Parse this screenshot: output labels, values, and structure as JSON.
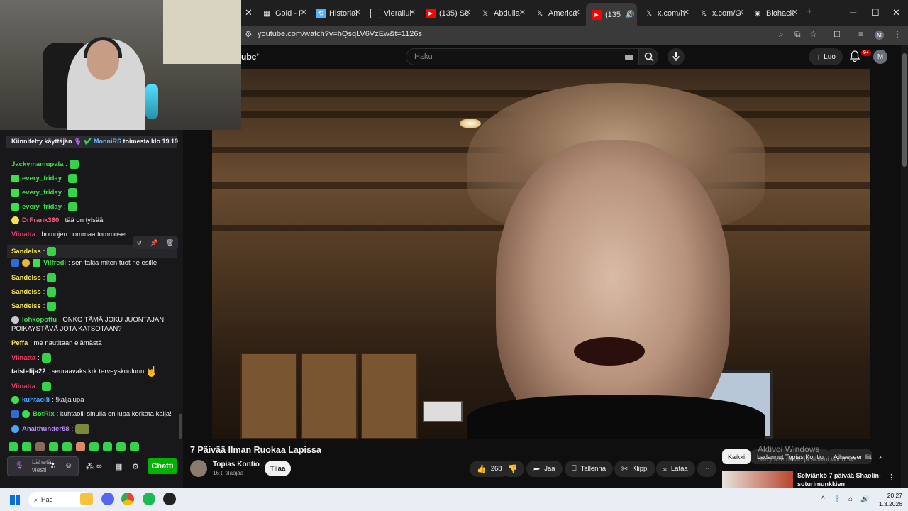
{
  "browser": {
    "tabs": [
      {
        "title": "Gold - P",
        "icon": "chart-icon",
        "color": "#ffffff"
      },
      {
        "title": "Historial",
        "icon": "history-icon",
        "color": "#4cb3ff"
      },
      {
        "title": "Vierailul",
        "icon": "page-icon",
        "color": "#9aa0a6"
      },
      {
        "title": "(135) Sel",
        "icon": "youtube-icon",
        "color": "#ff0000"
      },
      {
        "title": "Abdulla",
        "icon": "x-icon",
        "color": "#ffffff"
      },
      {
        "title": "America",
        "icon": "x-icon",
        "color": "#ffffff"
      },
      {
        "title": "(135",
        "icon": "youtube-icon",
        "color": "#ff0000"
      },
      {
        "title": "x.com/h",
        "icon": "x-icon",
        "color": "#ffffff"
      },
      {
        "title": "x.com/G",
        "icon": "x-icon",
        "color": "#ffffff"
      },
      {
        "title": "Biohack",
        "icon": "globe-icon",
        "color": "#ffffff"
      }
    ],
    "url": "youtube.com/watch?v=hQsqLV6VzEw&t=1126s"
  },
  "youtube": {
    "logo": "ube",
    "logo_region": "FI",
    "search_placeholder": "Haku",
    "create_label": "Luo",
    "notif_count": "9+",
    "avatar_letter": "M"
  },
  "video": {
    "title": "7 Päivää Ilman Ruokaa Lapissa",
    "channel": "Topias Kontio",
    "subs": "16 t. tilaajaa",
    "subscribe": "Tilaa",
    "likes": "268",
    "share": "Jaa",
    "save": "Tallenna",
    "clip": "Klippi",
    "download": "Lataa"
  },
  "sidebar": {
    "chips": [
      "Kaikki",
      "Ladannut Topias Kontio",
      "Aiheeseen liit"
    ],
    "related_title": "Selviänkö 7 päivää Shaolin-soturimunkkien koulutuksessa?"
  },
  "watermark": {
    "line1": "Aktivoi Windows",
    "line2": "Siirry asetuksiin ja aktivoi Windows."
  },
  "chat": {
    "pinned_prefix": "Kiinnitetty käyttäjän",
    "pinned_user": "MonniRS",
    "pinned_suffix": "toimesta klo 19.19",
    "messages": [
      {
        "user": "Jackymamupala",
        "color": "#3ce04a",
        "text": ""
      },
      {
        "user": "every_friday",
        "color": "#3ce04a",
        "text": ""
      },
      {
        "user": "every_friday",
        "color": "#3ce04a",
        "text": ""
      },
      {
        "user": "every_friday",
        "color": "#3ce04a",
        "text": ""
      },
      {
        "user": "DrFrank360",
        "color": "#ff5c8a",
        "text": "tää on tylsää"
      },
      {
        "user": "Viinatta",
        "color": "#ff3a6a",
        "text": "homojen hommaa tommoset"
      },
      {
        "user": "Sandelss",
        "color": "#f3e14b",
        "text": ""
      },
      {
        "user": "Vilfredi",
        "color": "#3ce04a",
        "text": "sen takia miten tuot ne esille"
      },
      {
        "user": "Sandelss",
        "color": "#f3e14b",
        "text": ""
      },
      {
        "user": "Sandelss",
        "color": "#f3e14b",
        "text": ""
      },
      {
        "user": "Sandelss",
        "color": "#f3e14b",
        "text": ""
      },
      {
        "user": "lohkopottu",
        "color": "#3ce04a",
        "text": "ONKO TÄMÄ JOKU JUONTAJAN"
      },
      {
        "user": "",
        "color": "#efeff1",
        "text": "POIKAYSTÄVÄ JOTA KATSOTAAN?"
      },
      {
        "user": "Peffa",
        "color": "#f3e14b",
        "text": "me nautitaan elämästä"
      },
      {
        "user": "Viinatta",
        "color": "#ff3a6a",
        "text": ""
      },
      {
        "user": "taistelija22",
        "color": "#efeff1",
        "text": "seuraavaks krk terveyskouluun :)"
      },
      {
        "user": "Viinatta",
        "color": "#ff3a6a",
        "text": ""
      },
      {
        "user": "kuhtaolli",
        "color": "#4da3ff",
        "text": "!kaljalupa"
      },
      {
        "user": "BotRix",
        "color": "#3ce04a",
        "text": "kuhtaolli sinulla on lupa korkata kalja!"
      },
      {
        "user": "Analthunder58",
        "color": "#b58cff",
        "text": ""
      }
    ],
    "input_placeholder": "Lähetä viesti",
    "send_label": "Chatti"
  },
  "taskbar": {
    "search": "Hae",
    "time": "20.27",
    "date": "1.3.2026"
  }
}
